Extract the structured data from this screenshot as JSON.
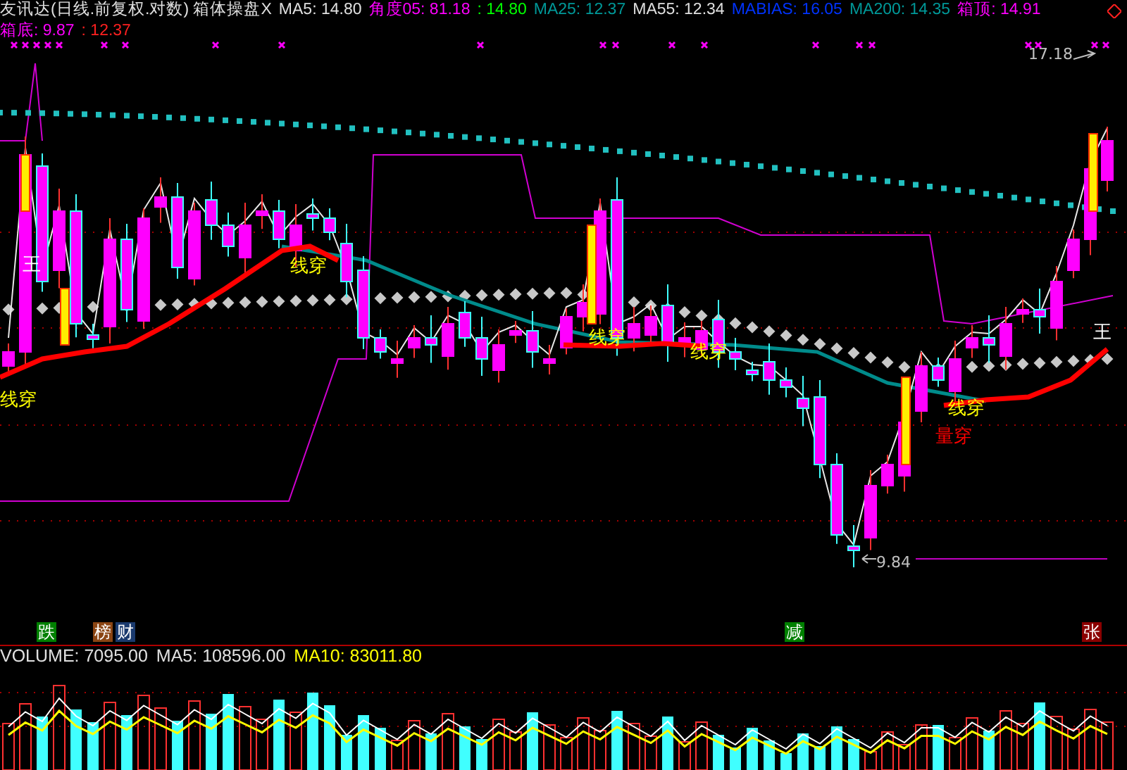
{
  "header": {
    "title": "友讯达(日线.前复权.对数) 箱体操盘X",
    "indicators": [
      {
        "text": "MA5: 14.80",
        "color": "#e0e0e0"
      },
      {
        "text": "角度05: 81.18",
        "color": "#ff00ff"
      },
      {
        "text": ": 14.80",
        "color": "#00ff00"
      },
      {
        "text": "MA25: 12.37",
        "color": "#009999"
      },
      {
        "text": "MA55: 12.34",
        "color": "#e0e0e0"
      },
      {
        "text": "MABIAS: 16.05",
        "color": "#0033ff"
      },
      {
        "text": "MA200: 14.35",
        "color": "#009999"
      },
      {
        "text": "箱顶: 14.91",
        "color": "#ff00ff"
      }
    ],
    "second_line": [
      {
        "text": "箱底: 9.87",
        "color": "#ff00ff"
      },
      {
        "text": ": 12.37",
        "color": "#ff2020"
      }
    ]
  },
  "chart_labels": [
    {
      "kind": "signal",
      "text": "王",
      "color": "#ffffff"
    },
    {
      "kind": "signal",
      "text": "线穿",
      "color": "#ffff00"
    },
    {
      "kind": "signal",
      "text": "线穿",
      "color": "#ffff00"
    },
    {
      "kind": "signal",
      "text": "线穿",
      "color": "#ffff00"
    },
    {
      "kind": "signal",
      "text": "线穿",
      "color": "#ffff00"
    },
    {
      "kind": "signal",
      "text": "量穿",
      "color": "#ff0000"
    },
    {
      "kind": "signal",
      "text": "线穿",
      "color": "#ffff00"
    },
    {
      "kind": "signal",
      "text": "王",
      "color": "#ffffff"
    },
    {
      "kind": "price",
      "text": "17.18",
      "color": "#c0c0c0"
    },
    {
      "kind": "price",
      "text": "9.84",
      "color": "#c0c0c0"
    }
  ],
  "badges": [
    {
      "text": "跌",
      "color": "#008000"
    },
    {
      "text": "榜",
      "color": "#8b4513"
    },
    {
      "text": "财",
      "color": "#1a3a6e"
    },
    {
      "text": "减",
      "color": "#008000"
    },
    {
      "text": "张",
      "color": "#8b0000"
    }
  ],
  "volume": {
    "indicators": [
      {
        "text": "VOLUME: 7095.00",
        "color": "#e0e0e0"
      },
      {
        "text": "MA5: 108596.00",
        "color": "#e0e0e0"
      },
      {
        "text": "MA10: 83011.80",
        "color": "#ffff00"
      }
    ]
  }
}
